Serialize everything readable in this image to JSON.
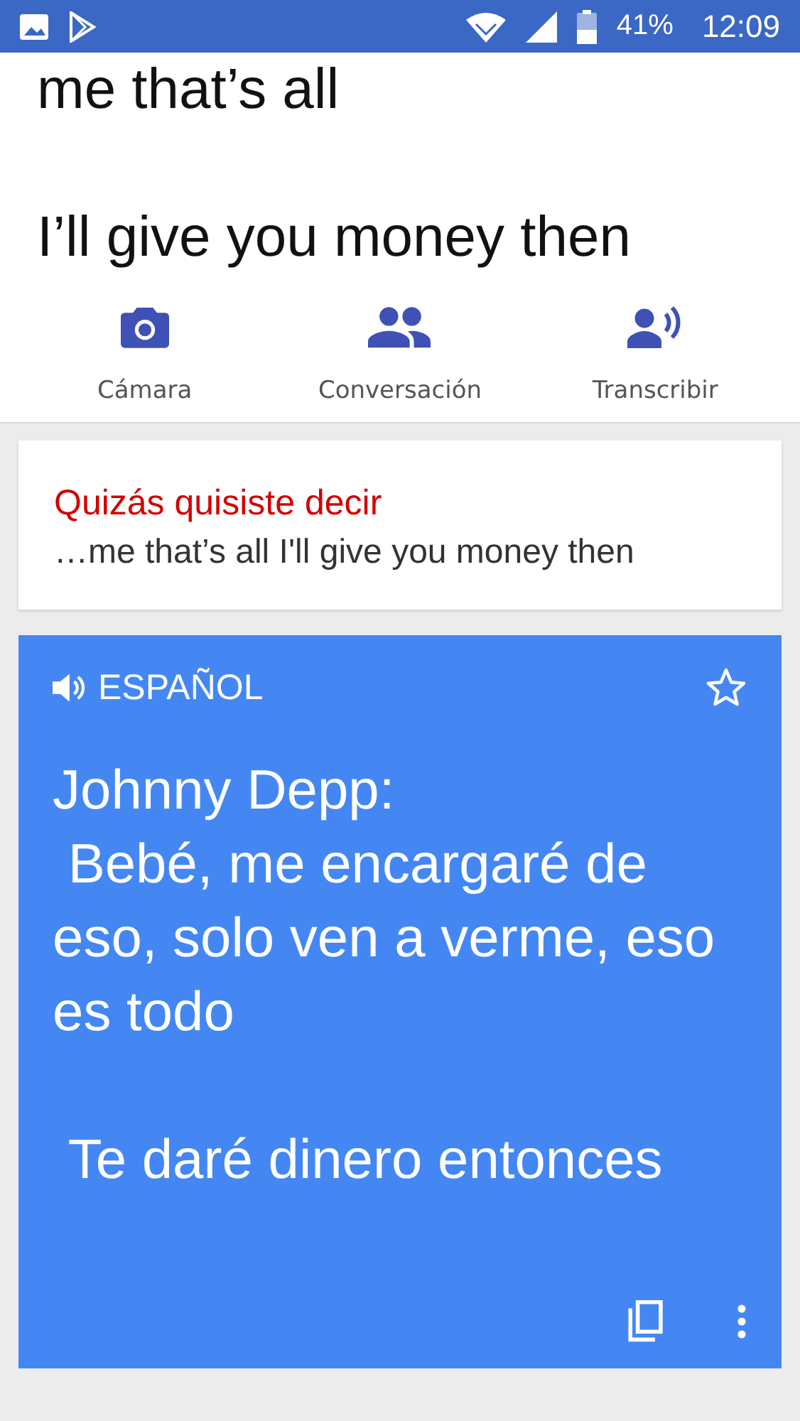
{
  "status_bar": {
    "battery_percent": "41%",
    "time": "12:09"
  },
  "source_text": "me that’s all\n\nI’ll give you money then",
  "actions": [
    {
      "kind": "camera",
      "label": "Cámara"
    },
    {
      "kind": "conversation",
      "label": "Conversación"
    },
    {
      "kind": "transcribe",
      "label": "Transcribir"
    }
  ],
  "suggestion": {
    "heading": "Quizás quisiste decir",
    "text": "…me that’s all I'll give you money then"
  },
  "translation": {
    "language": "ESPAÑOL",
    "starred": false,
    "text": "Johnny Depp:\n Bebé, me encargaré de eso, solo ven a verme, eso es todo\n\n Te daré dinero entonces"
  }
}
